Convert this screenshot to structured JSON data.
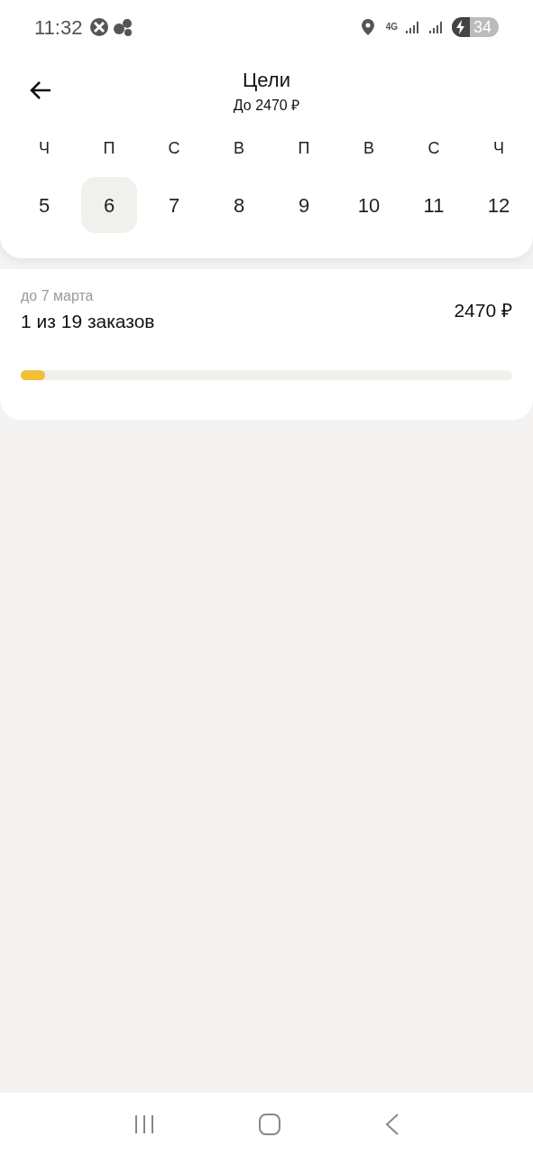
{
  "status_bar": {
    "time": "11:32",
    "network": "4G",
    "battery": "34"
  },
  "header": {
    "title": "Цели",
    "subtitle": "До 2470 ₽"
  },
  "days": [
    {
      "weekday": "Ч",
      "date": "5",
      "selected": false
    },
    {
      "weekday": "П",
      "date": "6",
      "selected": true
    },
    {
      "weekday": "С",
      "date": "7",
      "selected": false
    },
    {
      "weekday": "В",
      "date": "8",
      "selected": false
    },
    {
      "weekday": "П",
      "date": "9",
      "selected": false
    },
    {
      "weekday": "В",
      "date": "10",
      "selected": false
    },
    {
      "weekday": "С",
      "date": "11",
      "selected": false
    },
    {
      "weekday": "Ч",
      "date": "12",
      "selected": false
    }
  ],
  "goal": {
    "deadline": "до 7 марта",
    "progress_text": "1 из 19 заказов",
    "amount": "2470 ₽",
    "level": 0.05
  }
}
